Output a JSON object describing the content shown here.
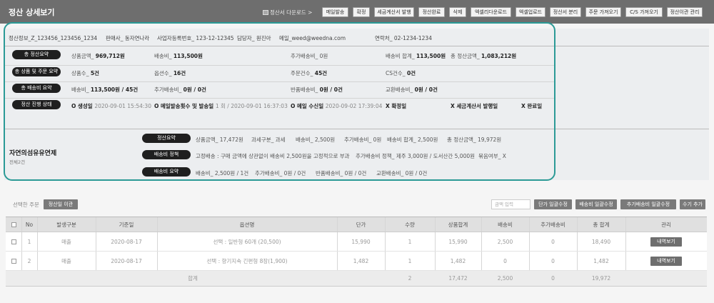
{
  "header": {
    "title": "정산 상세보기",
    "download_label": "정산서 다운로드 >",
    "buttons": [
      "메일발송",
      "확정",
      "세금계산서 발행",
      "정산완료",
      "삭제",
      "엑셀리다운로드",
      "엑셀업로드",
      "정산서 분리",
      "주문 가져오기",
      "C/S 가져오기",
      "정산이관 관리"
    ]
  },
  "info": {
    "settlement_info": "정산정보_Z_123456_123456_1234",
    "seller": "판매사_ 동자연나라",
    "business_no": "사업자등록번호_ 123-12-12345",
    "manager": "담당자_ 원진아",
    "email": "메일_weed@weedna.com",
    "phone": "연락처_ 02-1234-1234"
  },
  "summary": {
    "total_label": "총 정산요약",
    "total": {
      "product_amount_label": "상품금액_",
      "product_amount": "969,712원",
      "shipping_label": "배송비_",
      "shipping": "113,500원",
      "extra_shipping": "추가배송비_ 0원",
      "shipping_total_label": "배송비 합계_",
      "shipping_total": "113,500원",
      "grand_total_label": "총 정산금액_",
      "grand_total": "1,083,212원"
    },
    "product_label": "총 상품 및 주문 요약",
    "product": {
      "goods_label": "상품수_",
      "goods": "5건",
      "options_label": "옵션수_",
      "options": "16건",
      "orders_label": "주문건수_",
      "orders": "45건",
      "cs_label": "CS건수_",
      "cs": "0건"
    },
    "shipping_label": "총 배송비 요약",
    "shipping": {
      "fee_label": "배송비_",
      "fee": "113,500원 / 45건",
      "extra_label": "추가배송비_",
      "extra": "0원 / 0건",
      "return_label": "반품배송비_",
      "return": "0원 / 0건",
      "exchange_label": "교환배송비_",
      "exchange": "0원 / 0건"
    },
    "status_label": "정산 진행 상태",
    "status": {
      "created": "O 생성일",
      "created_ts": "2020-09-01 15:54:30",
      "mail_sent": "O 메일발송횟수 및 발송일",
      "mail_sent_ts": "1 회 / 2020-09-01 16:37:03",
      "mail_received": "O 메일 수신일",
      "mail_received_ts": "2020-09-02 17:39:04",
      "confirmed": "X 확정일",
      "tax_invoice": "X 세금계산서 발행일",
      "completed": "X 완료일"
    }
  },
  "vendor": {
    "name": "자연의섬유유연제",
    "count": "전체2건",
    "settle_label": "정산요약",
    "settle": [
      "상품금액_ 17,472원",
      "과세구분_ 과세",
      "배송비_ 2,500원",
      "추가배송비_ 0원",
      "배송비 합계_ 2,500원",
      "총 정산금액_ 19,972원"
    ],
    "policy_label": "배송비 정책",
    "policy": [
      "고정배송 : 구매 금액에 상관없이 배송비 2,500원을 고정적으로 부과",
      "추가배송비 정책_ 제주 3,000원 / 도서산간 5,000원",
      "묶음여부_ X"
    ],
    "ship_label": "배송비 요약",
    "ship": [
      "배송비_ 2,500원 / 1건",
      "추가배송비_ 0원 / 0건",
      "반품배송비_ 0원 / 0건",
      "교환배송비_ 0원 / 0건"
    ]
  },
  "lower": {
    "selected_label": "선택한 주문",
    "transfer_button": "정산일 이관",
    "search_placeholder": "금액 입력",
    "bulk_buttons": [
      "단가 일괄수정",
      "배송비 일괄수정",
      "추가배송비 일괄수정",
      "수기 추가"
    ]
  },
  "table": {
    "columns": [
      "No",
      "발생구분",
      "기준일",
      "옵션명",
      "단가",
      "수량",
      "상품합계",
      "배송비",
      "추가배송비",
      "총 합계",
      "관리"
    ],
    "rows": [
      {
        "no": "1",
        "type": "매출",
        "date": "2020-08-17",
        "option": "선택 : 일반형 60개 (20,500)",
        "price": "15,990",
        "qty": "1",
        "subtotal": "15,990",
        "shipping": "2,500",
        "extra": "0",
        "total": "18,490",
        "action": "내역보기"
      },
      {
        "no": "2",
        "type": "매출",
        "date": "2020-08-17",
        "option": "선택 : 향기지속 긴편형 8장(1,900)",
        "price": "1,482",
        "qty": "1",
        "subtotal": "1,482",
        "shipping": "0",
        "extra": "0",
        "total": "1,482",
        "action": "내역보기"
      }
    ],
    "total": {
      "label": "합계",
      "qty": "2",
      "subtotal": "17,472",
      "shipping": "2,500",
      "extra": "0",
      "total": "19,972"
    }
  }
}
